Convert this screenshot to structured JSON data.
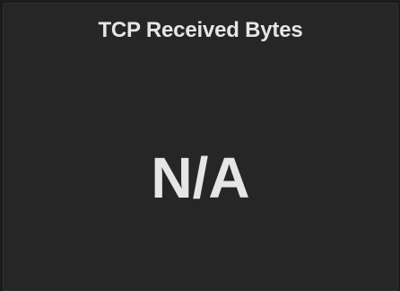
{
  "panel": {
    "title": "TCP Received Bytes",
    "value": "N/A"
  },
  "colors": {
    "background": "#1b1b1b",
    "panel_background": "#262626",
    "text": "#e6e6e6"
  }
}
